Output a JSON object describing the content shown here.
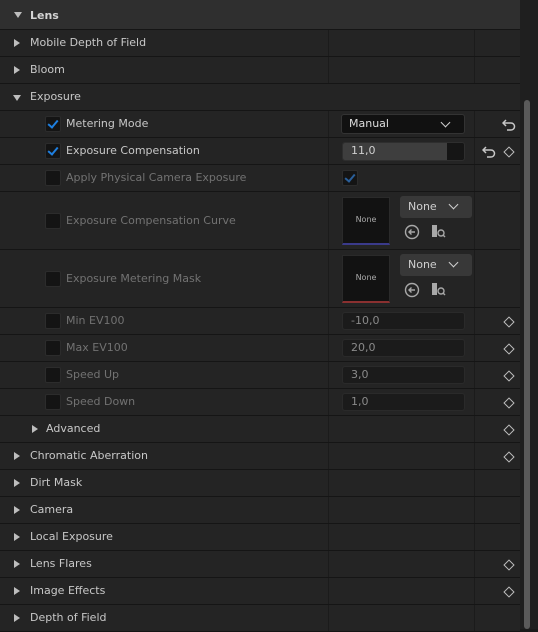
{
  "section_title": "Lens",
  "rows": {
    "mobile_dof": "Mobile Depth of Field",
    "bloom": "Bloom",
    "exposure": "Exposure",
    "metering_mode": "Metering Mode",
    "exposure_compensation": "Exposure Compensation",
    "apply_physical": "Apply Physical Camera Exposure",
    "comp_curve": "Exposure Compensation Curve",
    "metering_mask": "Exposure Metering Mask",
    "min_ev": "Min EV100",
    "max_ev": "Max EV100",
    "speed_up": "Speed Up",
    "speed_down": "Speed Down",
    "advanced": "Advanced",
    "chromatic": "Chromatic Aberration",
    "dirt_mask": "Dirt Mask",
    "camera": "Camera",
    "local_exposure": "Local Exposure",
    "lens_flares": "Lens Flares",
    "image_effects": "Image Effects",
    "depth_of_field": "Depth of Field"
  },
  "values": {
    "metering_mode": "Manual",
    "exposure_compensation": "11,0",
    "exposure_compensation_fill": 0.86,
    "none_thumb": "None",
    "none_dropdown": "None",
    "min_ev": "-10,0",
    "max_ev": "20,0",
    "speed_up": "3,0",
    "speed_down": "1,0"
  },
  "checks": {
    "metering_mode": true,
    "exposure_compensation": true,
    "apply_physical_value": true
  },
  "colors": {
    "accent": "#1e7fe0",
    "curve_underline": "#3a3a8a",
    "mask_underline": "#8a3030"
  }
}
